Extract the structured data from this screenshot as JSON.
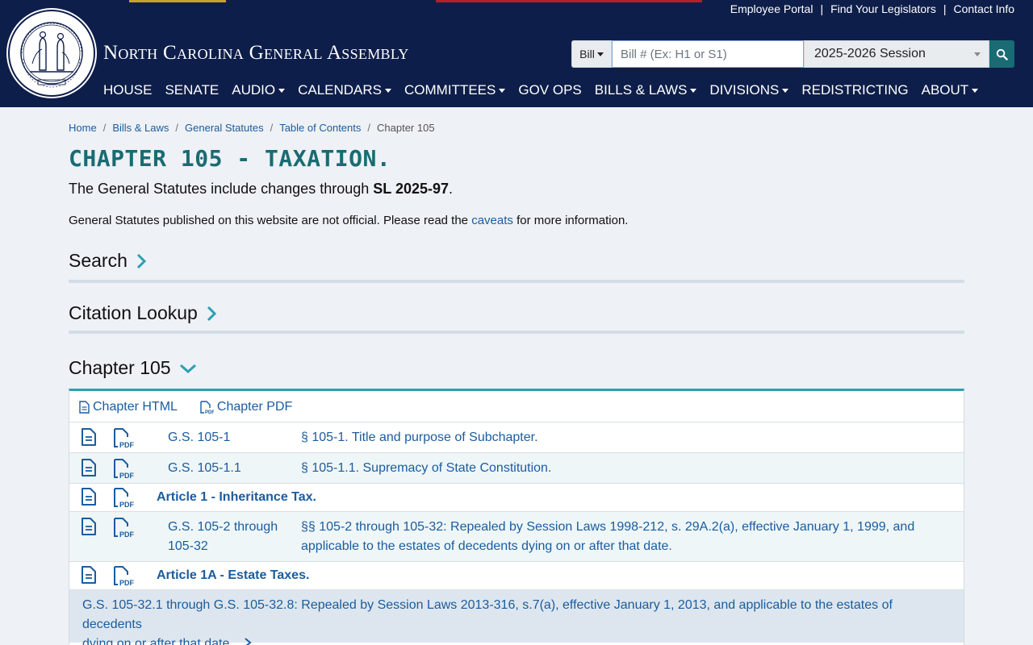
{
  "header": {
    "site_title": "North Carolina General Assembly",
    "utility_links": [
      "Employee Portal",
      "Find Your Legislators",
      "Contact Info"
    ],
    "search": {
      "bill_type": "Bill",
      "placeholder": "Bill # (Ex: H1 or S1)",
      "session": "2025-2026 Session"
    },
    "nav": [
      {
        "label": "HOUSE",
        "dropdown": false
      },
      {
        "label": "SENATE",
        "dropdown": false
      },
      {
        "label": "AUDIO",
        "dropdown": true
      },
      {
        "label": "CALENDARS",
        "dropdown": true
      },
      {
        "label": "COMMITTEES",
        "dropdown": true
      },
      {
        "label": "GOV OPS",
        "dropdown": false
      },
      {
        "label": "BILLS & LAWS",
        "dropdown": true
      },
      {
        "label": "DIVISIONS",
        "dropdown": true
      },
      {
        "label": "REDISTRICTING",
        "dropdown": false
      },
      {
        "label": "ABOUT",
        "dropdown": true
      }
    ]
  },
  "breadcrumb": [
    "Home",
    "Bills & Laws",
    "General Statutes",
    "Table of Contents",
    "Chapter 105"
  ],
  "page": {
    "title": "CHAPTER 105 - TAXATION.",
    "changes_prefix": "The General Statutes include changes through",
    "changes_law": "SL 2025-97",
    "changes_suffix": ".",
    "disclaimer_prefix": "General Statutes published on this website are not official. Please read the",
    "disclaimer_link": "caveats",
    "disclaimer_suffix": "for more information."
  },
  "sections": {
    "search": "Search",
    "citation_lookup": "Citation Lookup",
    "chapter": "Chapter 105"
  },
  "panel": {
    "chapter_html": "Chapter HTML",
    "chapter_pdf": "Chapter PDF",
    "rows": [
      {
        "gs": "G.S. 105-1",
        "desc": "§ 105-1. Title and purpose of Subchapter."
      },
      {
        "gs": "G.S. 105-1.1",
        "desc": "§ 105-1.1. Supremacy of State Constitution."
      },
      {
        "article": "Article 1 - Inheritance Tax."
      },
      {
        "gs_line1": "G.S. 105-2 through",
        "gs_line2": "105-32",
        "desc_line1": "§§ 105-2 through 105-32: Repealed by Session Laws 1998-212, s. 29A.2(a), effective January 1, 1999, and",
        "desc_line2": "applicable to the estates of decedents dying on or after that date."
      },
      {
        "article": "Article 1A - Estate Taxes."
      },
      {
        "repealed_line1": "G.S. 105-32.1 through G.S. 105-32.8: Repealed by Session Laws 2013-316, s.7(a), effective January 1, 2013, and applicable to the estates of decedents",
        "repealed_line2": "dying on or after that date."
      }
    ]
  },
  "colors": {
    "header_bg": "#0e1e4a",
    "title_teal": "#1a6b73",
    "link_blue": "#1b5c9e",
    "panel_accent": "#2aa1b3",
    "page_bg": "#eef1f5"
  }
}
